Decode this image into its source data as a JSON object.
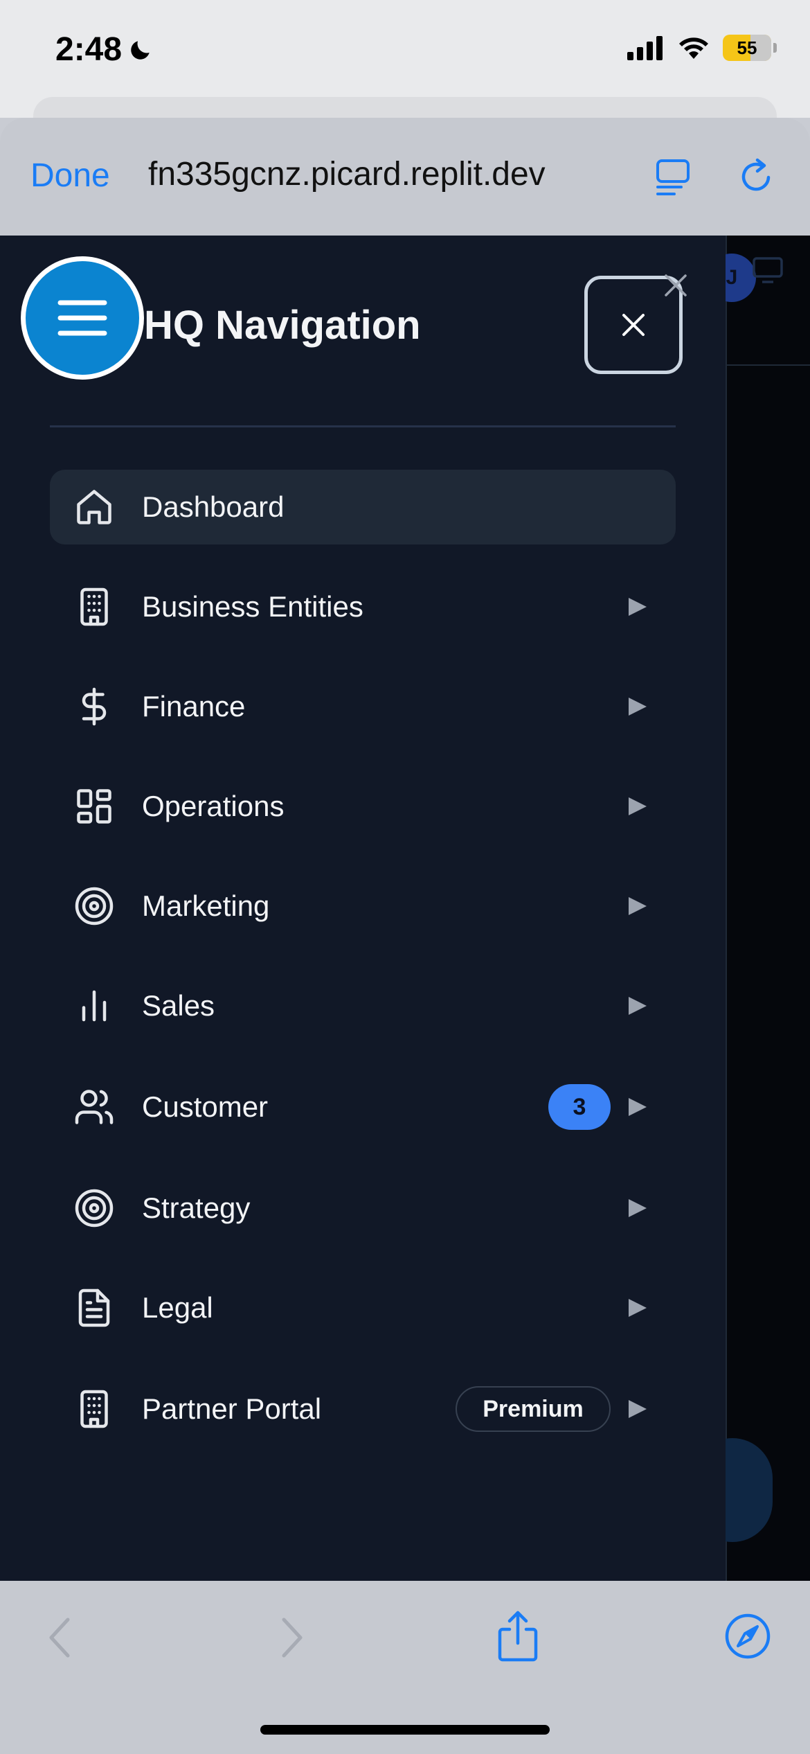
{
  "status_bar": {
    "time": "2:48",
    "battery": "55"
  },
  "browser": {
    "done_label": "Done",
    "url": "fn335gcnz.picard.replit.dev"
  },
  "drawer": {
    "title": "HQ Navigation",
    "items": [
      {
        "label": "Dashboard",
        "icon": "home-icon",
        "active": true
      },
      {
        "label": "Business Entities",
        "icon": "building-icon"
      },
      {
        "label": "Finance",
        "icon": "dollar-icon"
      },
      {
        "label": "Operations",
        "icon": "layout-grid-icon"
      },
      {
        "label": "Marketing",
        "icon": "target-icon"
      },
      {
        "label": "Sales",
        "icon": "bar-chart-icon"
      },
      {
        "label": "Customer",
        "icon": "users-icon",
        "badge": "3"
      },
      {
        "label": "Strategy",
        "icon": "target-icon"
      },
      {
        "label": "Legal",
        "icon": "file-text-icon"
      },
      {
        "label": "Partner Portal",
        "icon": "building-icon",
        "tag": "Premium"
      }
    ]
  },
  "background_page": {
    "avatar_initial": "J"
  },
  "colors": {
    "drawer_bg": "#111827",
    "active_item_bg": "#1f2937",
    "accent_blue": "#1a7cf5",
    "menu_fab": "#0b84d0",
    "badge_blue": "#3b82f6"
  }
}
